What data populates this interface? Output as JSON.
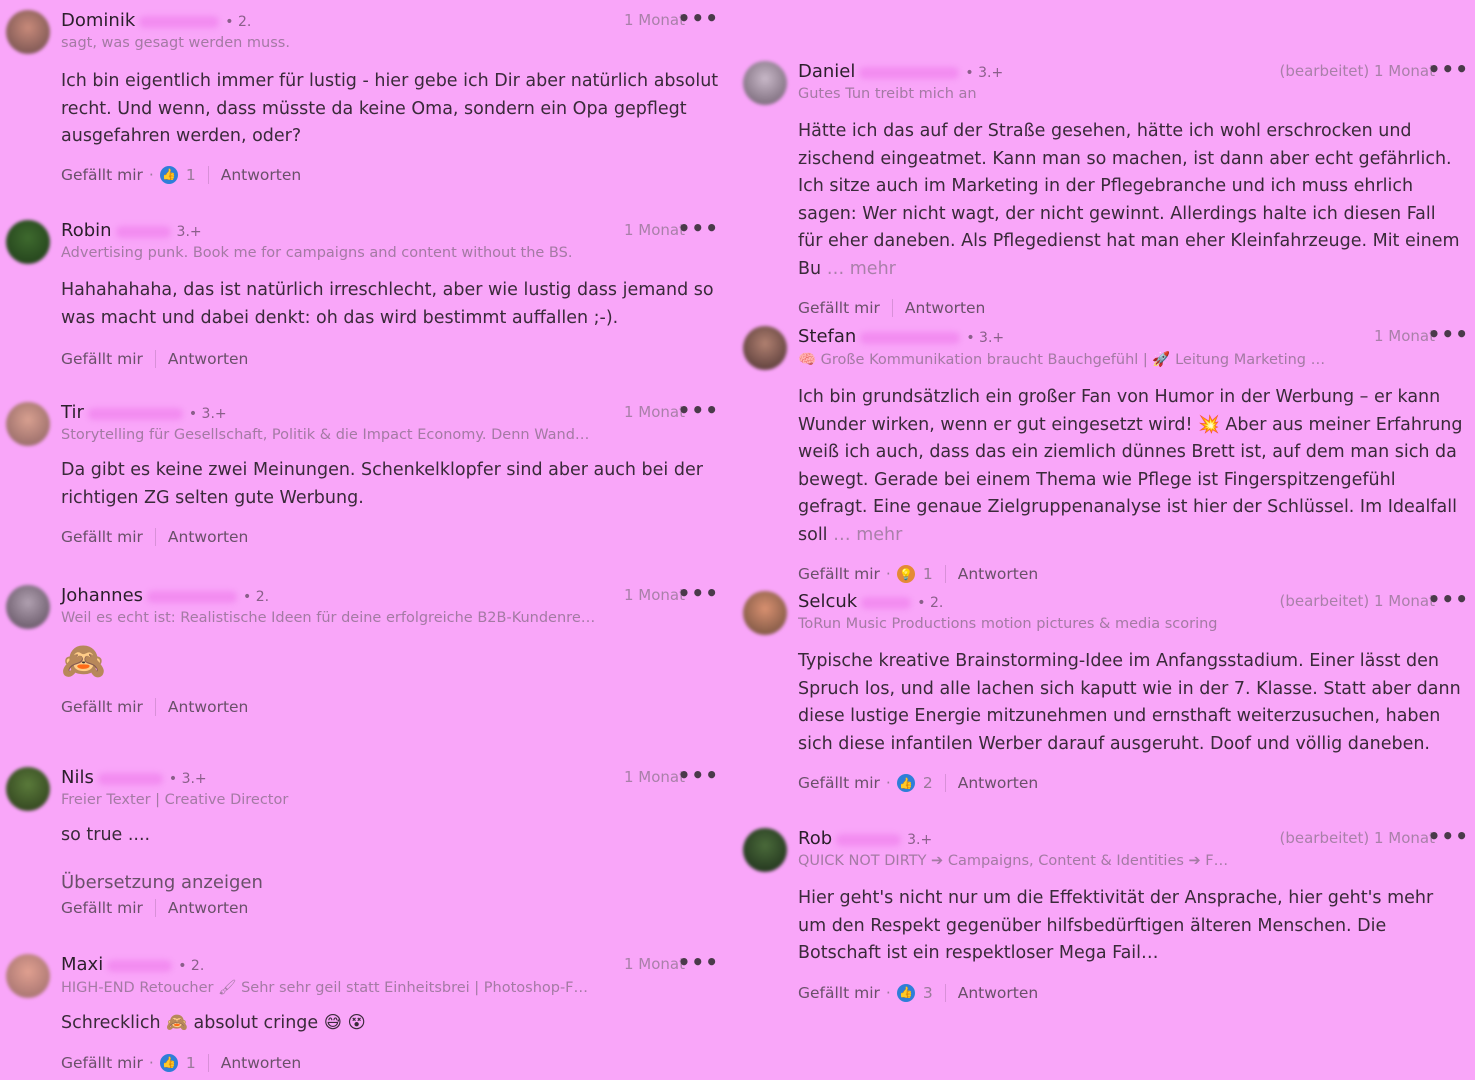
{
  "labels": {
    "like": "Gefällt mir",
    "reply": "Antworten",
    "more": "…",
    "see_more": "… mehr",
    "translate": "Übersetzung anzeigen",
    "dot": "·"
  },
  "left": [
    {
      "name": "Dominik",
      "degree": "• 2.",
      "time": "1 Monat",
      "headline": "sagt, was gesagt werden muss.",
      "text": "Ich bin eigentlich immer für lustig - hier gebe ich Dir aber natürlich absolut recht. Und wenn, dass müsste da keine Oma, sondern ein Opa gepflegt ausgefahren werden, oder?",
      "likes": "1"
    },
    {
      "name": "Robin",
      "degree": "3.+",
      "time": "1 Monat",
      "headline": "Advertising punk. Book me for campaigns and content without the BS.",
      "text": "Hahahahaha, das ist natürlich irreschlecht, aber wie lustig dass jemand so was macht und dabei denkt: oh das wird bestimmt auffallen ;-)."
    },
    {
      "name": "Tir",
      "degree": "• 3.+",
      "time": "1 Monat",
      "headline": "Storytelling für Gesellschaft, Politik & die Impact Economy. Denn Wand…",
      "text": "Da gibt es keine zwei Meinungen. Schenkelklopfer sind aber auch bei der richtigen ZG selten gute Werbung."
    },
    {
      "name": "Johannes",
      "degree": "• 2.",
      "time": "1 Monat",
      "headline": "Weil es echt ist: Realistische Ideen für deine erfolgreiche B2B-Kundenrei…",
      "emoji": "🙈"
    },
    {
      "name": "Nils",
      "degree": "• 3.+",
      "time": "1 Monat",
      "headline": "Freier Texter | Creative Director",
      "text": "so true ...."
    },
    {
      "name": "Maxi",
      "degree": "• 2.",
      "time": "1 Monat",
      "headline": "HIGH-END Retoucher 🖌 Sehr sehr geil statt Einheitsbrei | Photoshop-F…",
      "text": "Schrecklich 🙈 absolut cringe 😅 😵",
      "likes": "1"
    }
  ],
  "right": [
    {
      "name": "Daniel",
      "degree": "• 3.+",
      "time": "(bearbeitet) 1 Monat",
      "headline": "Gutes Tun treibt mich an",
      "text": "Hätte ich das auf der Straße gesehen, hätte ich wohl erschrocken und zischend eingeatmet. Kann man so machen, ist dann aber echt gefährlich. Ich sitze auch im Marketing in der Pflegebranche und ich muss ehrlich sagen: Wer nicht wagt, der nicht gewinnt. Allerdings halte ich diesen Fall für eher daneben. Als Pflegedienst hat man eher Kleinfahrzeuge. Mit einem Bu"
    },
    {
      "name": "Stefan",
      "degree": "• 3.+",
      "time": "1 Monat",
      "headline": "🧠 Große Kommunikation braucht Bauchgefühl | 🚀 Leitung Marketing …",
      "text": "Ich bin grundsätzlich ein großer Fan von Humor in der Werbung – er kann Wunder wirken, wenn er gut eingesetzt wird! 💥 Aber aus meiner Erfahrung weiß ich auch, dass das ein ziemlich dünnes Brett ist, auf dem man sich da bewegt. Gerade bei einem Thema wie Pflege ist Fingerspitzengefühl gefragt. Eine genaue Zielgruppenanalyse ist hier der Schlüssel. Im Idealfall soll",
      "likes": "1"
    },
    {
      "name": "Selcuk",
      "degree": "• 2.",
      "time": "(bearbeitet) 1 Monat",
      "headline": "ToRun Music Productions motion pictures & media scoring",
      "text": "Typische kreative Brainstorming-Idee im Anfangsstadium. Einer lässt den Spruch los, und alle lachen sich kaputt wie in der 7. Klasse. Statt aber dann diese lustige Energie mitzunehmen und ernsthaft weiterzusuchen, haben sich diese infantilen Werber darauf ausgeruht. Doof und völlig daneben.",
      "likes": "2"
    },
    {
      "name": "Rob",
      "degree": "3.+",
      "time": "(bearbeitet) 1 Monat",
      "headline": "QUICK NOT DIRTY ➔ Campaigns, Content & Identities ➔ F…",
      "text": "Hier geht's nicht nur um die Effektivität der Ansprache, hier geht's mehr um den Respekt gegenüber hilfsbedürftigen älteren Menschen. Die Botschaft ist ein respektloser Mega Fail…",
      "likes": "3"
    }
  ]
}
